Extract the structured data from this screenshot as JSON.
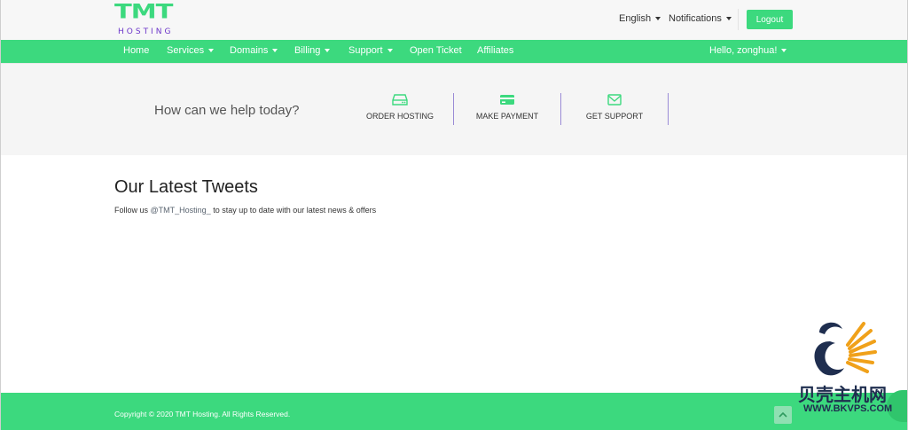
{
  "topbar": {
    "logo_text": "TMT",
    "logo_sub": "HOSTING",
    "language": "English",
    "notifications": "Notifications",
    "logout": "Logout"
  },
  "nav": {
    "items": [
      {
        "label": "Home",
        "dropdown": false
      },
      {
        "label": "Services",
        "dropdown": true
      },
      {
        "label": "Domains",
        "dropdown": true
      },
      {
        "label": "Billing",
        "dropdown": true
      },
      {
        "label": "Support",
        "dropdown": true
      },
      {
        "label": "Open Ticket",
        "dropdown": false
      },
      {
        "label": "Affiliates",
        "dropdown": false
      }
    ],
    "user": "Hello, zonghua!"
  },
  "help": {
    "prompt": "How can we help today?",
    "links": [
      {
        "label": "ORDER HOSTING",
        "icon": "server-icon"
      },
      {
        "label": "MAKE PAYMENT",
        "icon": "credit-card-icon"
      },
      {
        "label": "GET SUPPORT",
        "icon": "envelope-icon"
      }
    ]
  },
  "tweets": {
    "title": "Our Latest Tweets",
    "prefix": "Follow us",
    "handle": "@TMT_Hosting_",
    "suffix": "to stay up to date with our latest news & offers"
  },
  "footer": {
    "copyright": "Copyright © 2020 TMT Hosting. All Rights Reserved.",
    "scroll_top_icon": "chevron-up-icon"
  },
  "watermark": {
    "text": "贝壳主机网",
    "url": "WWW.BKVPS.COM"
  },
  "colors": {
    "brand_green": "#3cd97e",
    "brand_purple": "#6b35c9",
    "divider_purple": "#9a8bd6"
  }
}
